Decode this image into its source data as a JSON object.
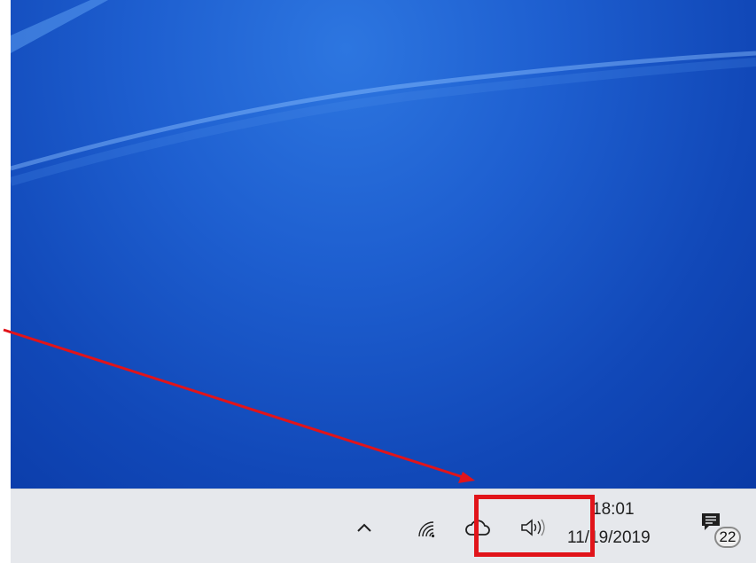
{
  "taskbar": {
    "tray": {
      "show_hidden_icon": "chevron-up-icon",
      "network_icon": "wifi-icon",
      "onedrive_icon": "cloud-icon",
      "volume_icon": "speaker-icon"
    },
    "clock": {
      "time": "18:01",
      "date": "11/19/2019"
    },
    "notifications": {
      "icon": "action-center-icon",
      "count": "22"
    }
  },
  "annotation": {
    "highlight_color": "#e1141a",
    "arrow_color": "#e1141a"
  },
  "colors": {
    "desktop_blue": "#1148b8",
    "taskbar_bg": "#e6e8ec"
  }
}
